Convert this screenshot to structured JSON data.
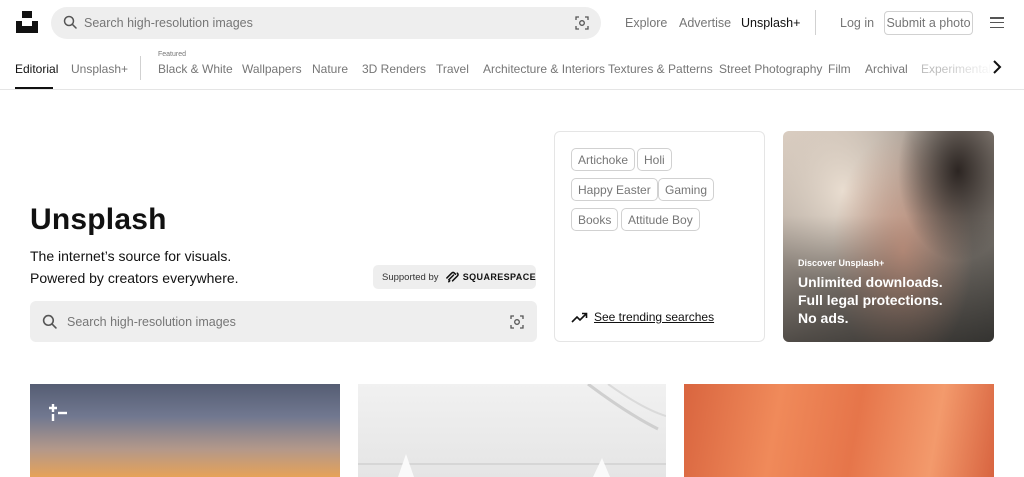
{
  "header": {
    "search_placeholder": "Search high-resolution images",
    "nav": {
      "explore": "Explore",
      "advertise": "Advertise",
      "unsplash_plus": "Unsplash+",
      "login": "Log in",
      "submit": "Submit a photo"
    }
  },
  "categories": {
    "editorial": "Editorial",
    "unsplash_plus": "Unsplash+",
    "featured_label": "Featured",
    "items": [
      "Black & White",
      "Wallpapers",
      "Nature",
      "3D Renders",
      "Travel",
      "Architecture & Interiors",
      "Textures & Patterns",
      "Street Photography",
      "Film",
      "Archival",
      "Experimental"
    ]
  },
  "hero": {
    "title": "Unsplash",
    "line1": "The internet’s source for visuals.",
    "line2": "Powered by creators everywhere.",
    "supported_by": "Supported by",
    "sponsor": "SQUARESPACE",
    "search_placeholder": "Search high-resolution images"
  },
  "trending": {
    "chips": [
      "Artichoke",
      "Holi",
      "Happy Easter",
      "Gaming",
      "Books",
      "Attitude Boy"
    ],
    "link": "See trending searches"
  },
  "promo": {
    "kicker": "Discover Unsplash+",
    "line1": "Unlimited downloads.",
    "line2": "Full legal protections.",
    "line3": "No ads."
  },
  "icons": {
    "logo": "unsplash-logo-icon",
    "search": "search-icon",
    "visual_search": "visual-search-icon",
    "menu": "hamburger-menu-icon",
    "next": "chevron-right-icon",
    "trending": "trending-arrow-icon"
  }
}
